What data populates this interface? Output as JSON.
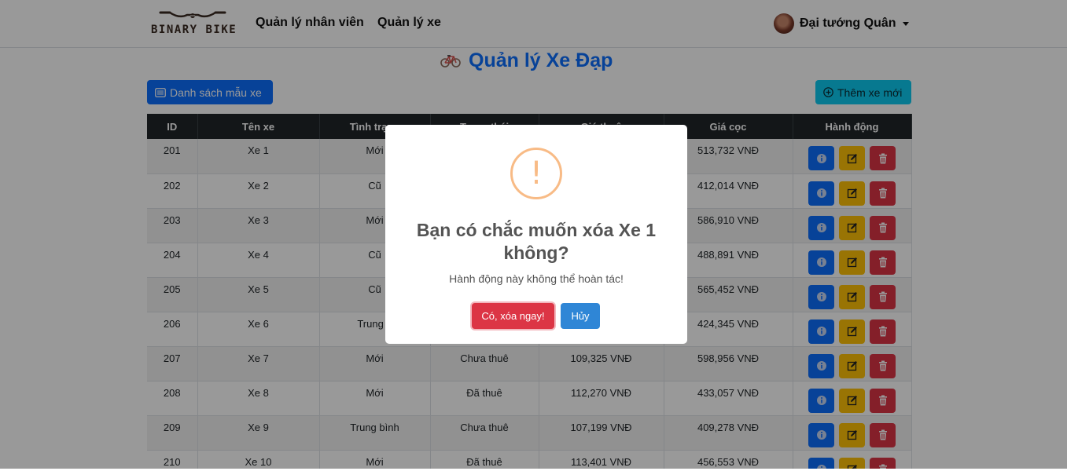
{
  "navbar": {
    "logo_text": "BINARY BIKE",
    "links": [
      "Quản lý nhân viên",
      "Quản lý xe"
    ],
    "user_name": "Đại tướng Quân"
  },
  "page": {
    "title": "Quản lý Xe Đạp",
    "list_button": "Danh sách mẫu xe",
    "add_button": "Thêm xe mới"
  },
  "table": {
    "headers": [
      "ID",
      "Tên xe",
      "Tình trạng",
      "Trạng thái",
      "Giá thuê",
      "Giá cọc",
      "Hành động"
    ],
    "rows": [
      {
        "id": "201",
        "name": "Xe 1",
        "condition": "Mới",
        "status": "",
        "rent": "",
        "deposit": "513,732 VNĐ"
      },
      {
        "id": "202",
        "name": "Xe 2",
        "condition": "Cũ",
        "status": "",
        "rent": "",
        "deposit": "412,014 VNĐ"
      },
      {
        "id": "203",
        "name": "Xe 3",
        "condition": "Mới",
        "status": "",
        "rent": "",
        "deposit": "586,910 VNĐ"
      },
      {
        "id": "204",
        "name": "Xe 4",
        "condition": "Cũ",
        "status": "",
        "rent": "",
        "deposit": "488,891 VNĐ"
      },
      {
        "id": "205",
        "name": "Xe 5",
        "condition": "Cũ",
        "status": "",
        "rent": "",
        "deposit": "565,452 VNĐ"
      },
      {
        "id": "206",
        "name": "Xe 6",
        "condition": "Trung b",
        "status": "",
        "rent": "",
        "deposit": "424,345 VNĐ"
      },
      {
        "id": "207",
        "name": "Xe 7",
        "condition": "Mới",
        "status": "Chưa thuê",
        "rent": "109,325 VNĐ",
        "deposit": "598,956 VNĐ"
      },
      {
        "id": "208",
        "name": "Xe 8",
        "condition": "Mới",
        "status": "Đã thuê",
        "rent": "112,270 VNĐ",
        "deposit": "433,057 VNĐ"
      },
      {
        "id": "209",
        "name": "Xe 9",
        "condition": "Trung bình",
        "status": "Chưa thuê",
        "rent": "107,199 VNĐ",
        "deposit": "409,278 VNĐ"
      },
      {
        "id": "210",
        "name": "Xe 10",
        "condition": "Mới",
        "status": "Đã thuê",
        "rent": "113,401 VNĐ",
        "deposit": "456,553 VNĐ"
      }
    ]
  },
  "modal": {
    "icon": "!",
    "title": "Bạn có chắc muốn xóa Xe 1 không?",
    "text": "Hành động này không thể hoàn tác!",
    "confirm": "Có, xóa ngay!",
    "cancel": "Hủy"
  },
  "colors": {
    "primary": "#0d6efd",
    "info": "#0dcaf0",
    "warning": "#ffc107",
    "danger": "#dc3545",
    "header_dark": "#212529",
    "warning_icon": "#f8bb86"
  },
  "icons": {
    "logo": "bike-handlebar-icon",
    "title": "bicycle-icon",
    "list_button": "list-icon",
    "add_button": "plus-circle-icon",
    "row_actions": [
      "info-icon",
      "edit-icon",
      "trash-icon"
    ],
    "modal": "warning-icon"
  }
}
